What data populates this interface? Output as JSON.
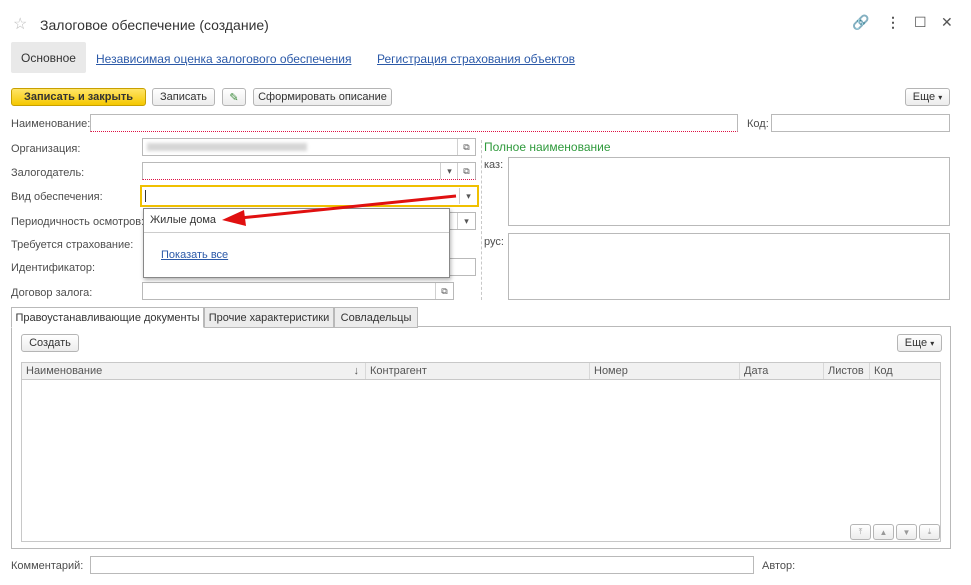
{
  "window": {
    "title": "Залоговое обеспечение (создание)"
  },
  "nav": {
    "tab_main": "Основное",
    "link_assessment": "Независимая оценка залогового обеспечения",
    "link_insurance": "Регистрация страхования объектов"
  },
  "toolbar": {
    "save_close": "Записать и закрыть",
    "save": "Записать",
    "generate_description": "Сформировать описание",
    "more": "Еще"
  },
  "form": {
    "name_label": "Наименование:",
    "code_label": "Код:",
    "organization_label": "Организация:",
    "pledger_label": "Залогодатель:",
    "collateral_type_label": "Вид обеспечения:",
    "inspection_label": "Периодичность осмотров:",
    "insurance_label": "Требуется страхование:",
    "identifier_label": "Идентификатор:",
    "pledge_contract_label": "Договор залога:",
    "full_name_title": "Полное наименование",
    "kaz_label": "каз:",
    "rus_label": "рус:",
    "comment_label": "Комментарий:",
    "author_label": "Автор:"
  },
  "dropdown": {
    "option": "Жилые дома",
    "show_all": "Показать все"
  },
  "bottom_tabs": [
    "Правоустанавливающие документы",
    "Прочие характеристики",
    "Совладельцы"
  ],
  "table": {
    "create": "Создать",
    "more": "Еще",
    "columns": [
      "Наименование",
      "Контрагент",
      "Номер",
      "Дата",
      "Листов",
      "Код"
    ],
    "sort_icon": "↓"
  },
  "colors": {
    "accent_yellow": "#f5c800",
    "link": "#2b59a8",
    "green_title": "#2f9a3c",
    "arrow_red": "#e01010"
  }
}
